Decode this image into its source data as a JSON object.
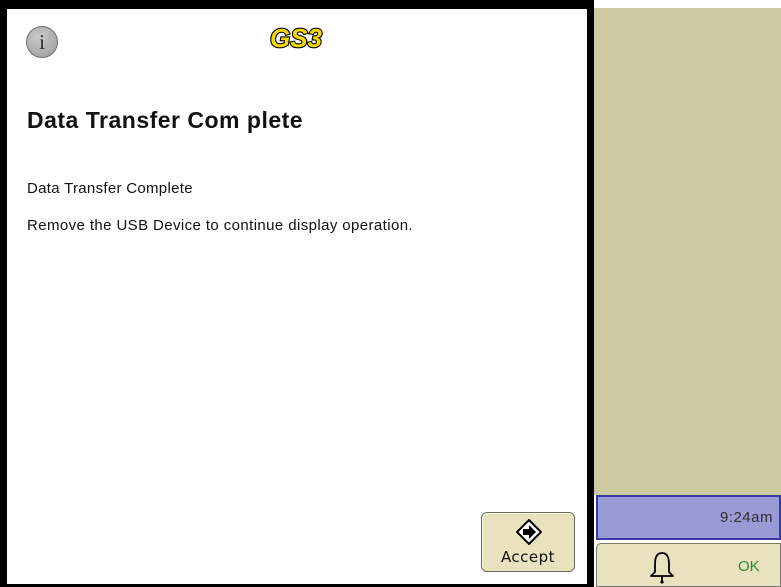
{
  "dialog": {
    "info_icon_glyph": "i",
    "logo_text": "GS3",
    "title": "Data Transfer Com plete",
    "message_line1": "Data Transfer Complete",
    "message_line2": "Remove the USB Device to continue display operation.",
    "accept_label": "Accept",
    "accept_icon": "arrow-right-icon"
  },
  "status": {
    "time": "9:24am",
    "alarm_icon": "bell-icon",
    "alarm_status": "OK"
  },
  "colors": {
    "logo_fill": "#f5d800",
    "panel_bg": "#cdcaa1",
    "time_bar_bg": "#9a9ad6",
    "ok_text": "#2e8b2e"
  }
}
